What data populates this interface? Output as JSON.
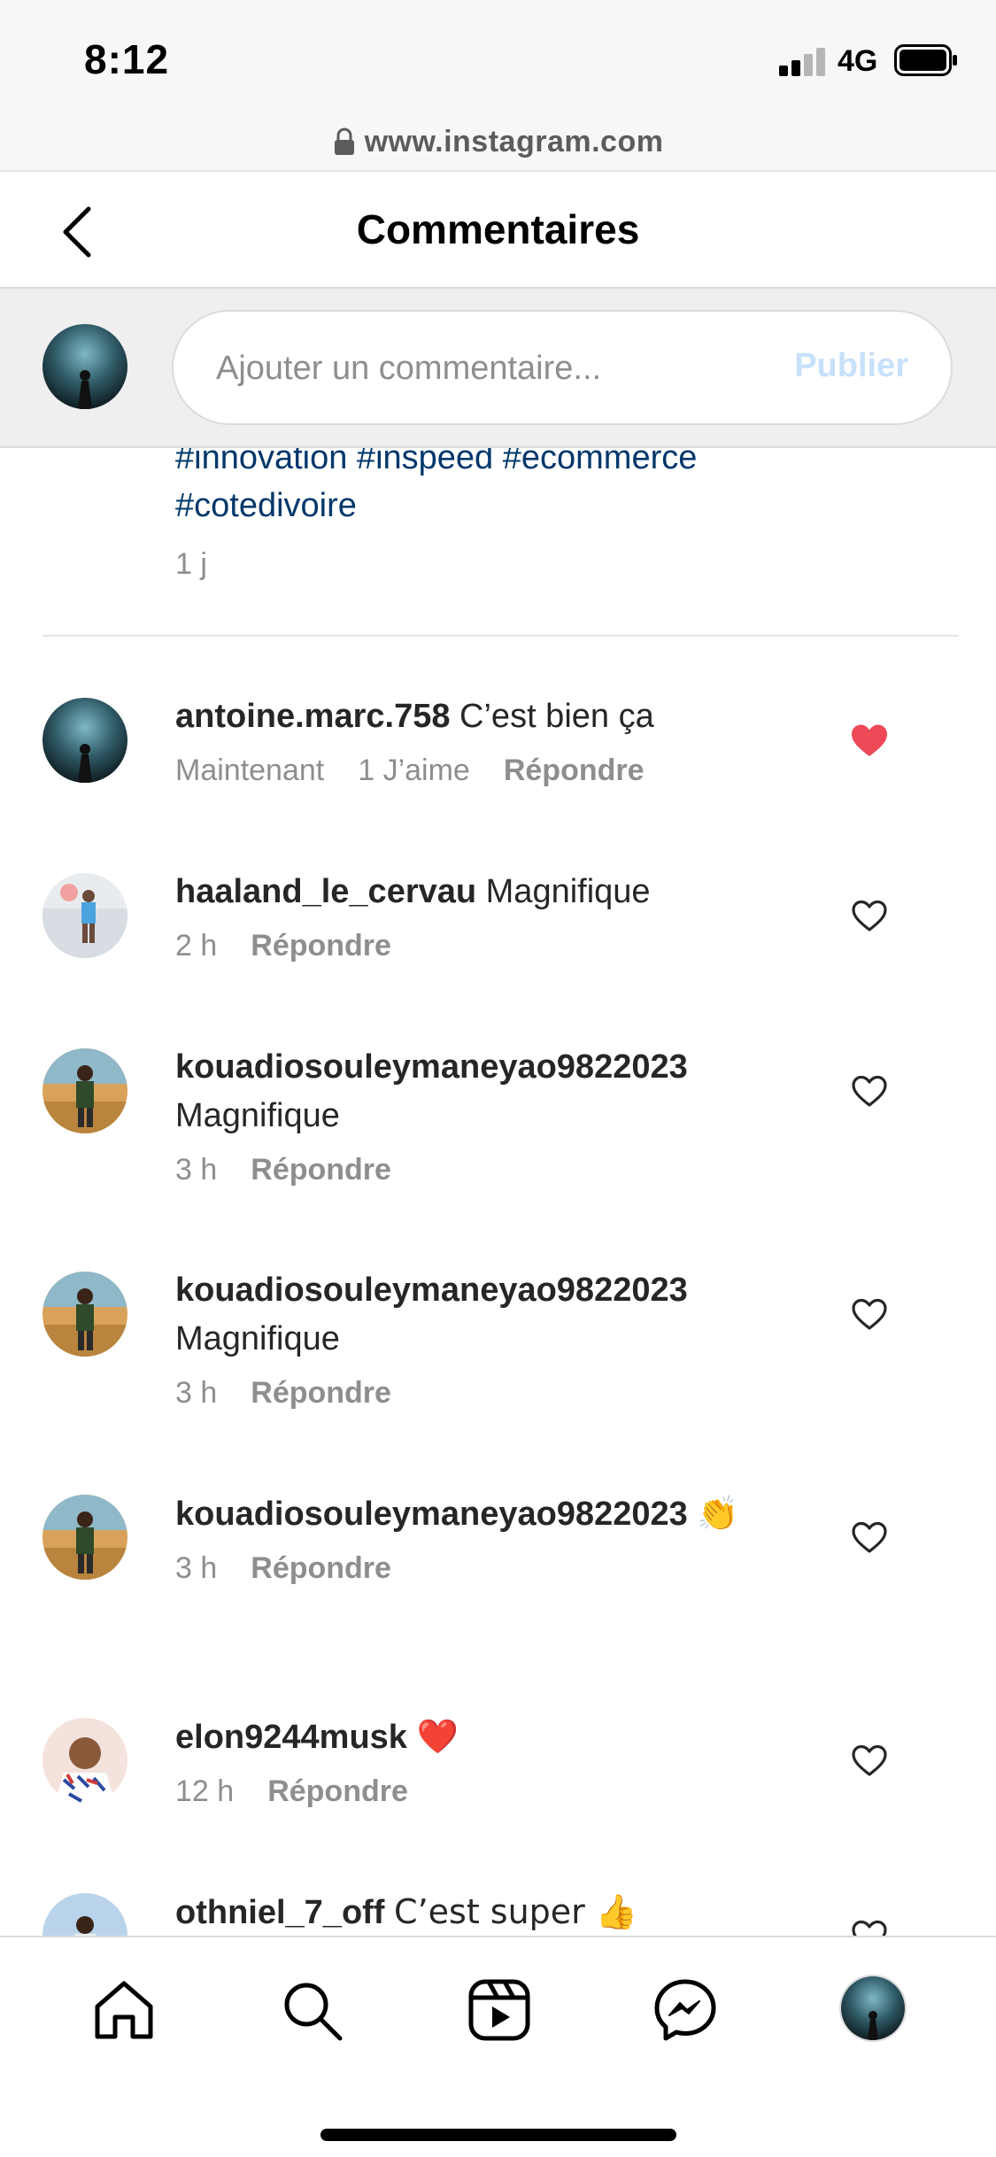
{
  "status_bar": {
    "time": "8:12",
    "network": "4G"
  },
  "browser": {
    "url": "www.instagram.com"
  },
  "header": {
    "title": "Commentaires"
  },
  "composer": {
    "placeholder": "Ajouter un commentaire...",
    "publish_label": "Publier"
  },
  "caption": {
    "hashtags_line1": "#innovation #inspeed #ecommerce",
    "hashtags_line2": "#cotedivoire",
    "time": "1 j"
  },
  "comments": [
    {
      "username": "antoine.marc.758",
      "text": "C’est bien ça",
      "time": "Maintenant",
      "likes": "1 J’aime",
      "reply": "Répondre",
      "liked": true
    },
    {
      "username": "haaland_le_cervau",
      "text": "Magnifique",
      "time": "2 h",
      "reply": "Répondre",
      "liked": false
    },
    {
      "username": "kouadiosouleymaneyao9822023",
      "text": "Magnifique",
      "time": "3 h",
      "reply": "Répondre",
      "liked": false
    },
    {
      "username": "kouadiosouleymaneyao9822023",
      "text": "Magnifique",
      "time": "3 h",
      "reply": "Répondre",
      "liked": false
    },
    {
      "username": "kouadiosouleymaneyao9822023",
      "text": "👏",
      "time": "3 h",
      "reply": "Répondre",
      "liked": false
    },
    {
      "username": "elon9244musk",
      "text": "❤️",
      "time": "12 h",
      "reply": "Répondre",
      "liked": false
    },
    {
      "username": "othniel_7_off",
      "text": "C’est super 👍",
      "time": "",
      "reply": "",
      "liked": false
    }
  ],
  "icons": {
    "back": "chevron-left-icon",
    "lock": "lock-icon",
    "heart_filled": "heart-filled-icon",
    "heart_outline": "heart-outline-icon",
    "home": "home-icon",
    "search": "search-icon",
    "reels": "reels-icon",
    "messenger": "messenger-icon"
  },
  "colors": {
    "link": "#00376b",
    "like": "#ed4956",
    "publish_disabled": "#c7e0fb",
    "muted": "#8e8e8e"
  }
}
